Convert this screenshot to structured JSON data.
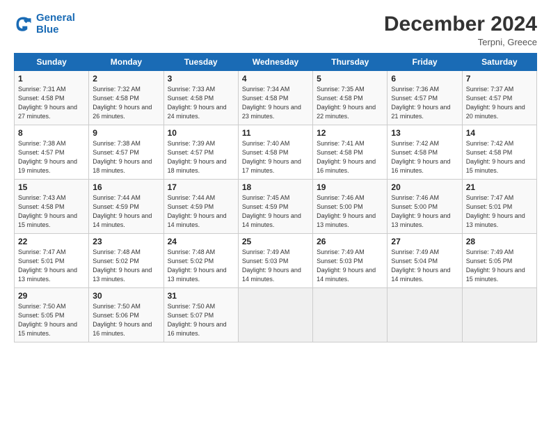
{
  "header": {
    "logo_line1": "General",
    "logo_line2": "Blue",
    "month": "December 2024",
    "location": "Terpni, Greece"
  },
  "columns": [
    "Sunday",
    "Monday",
    "Tuesday",
    "Wednesday",
    "Thursday",
    "Friday",
    "Saturday"
  ],
  "weeks": [
    [
      {
        "day": "1",
        "sunrise": "7:31 AM",
        "sunset": "4:58 PM",
        "daylight": "9 hours and 27 minutes."
      },
      {
        "day": "2",
        "sunrise": "7:32 AM",
        "sunset": "4:58 PM",
        "daylight": "9 hours and 26 minutes."
      },
      {
        "day": "3",
        "sunrise": "7:33 AM",
        "sunset": "4:58 PM",
        "daylight": "9 hours and 24 minutes."
      },
      {
        "day": "4",
        "sunrise": "7:34 AM",
        "sunset": "4:58 PM",
        "daylight": "9 hours and 23 minutes."
      },
      {
        "day": "5",
        "sunrise": "7:35 AM",
        "sunset": "4:58 PM",
        "daylight": "9 hours and 22 minutes."
      },
      {
        "day": "6",
        "sunrise": "7:36 AM",
        "sunset": "4:57 PM",
        "daylight": "9 hours and 21 minutes."
      },
      {
        "day": "7",
        "sunrise": "7:37 AM",
        "sunset": "4:57 PM",
        "daylight": "9 hours and 20 minutes."
      }
    ],
    [
      {
        "day": "8",
        "sunrise": "7:38 AM",
        "sunset": "4:57 PM",
        "daylight": "9 hours and 19 minutes."
      },
      {
        "day": "9",
        "sunrise": "7:38 AM",
        "sunset": "4:57 PM",
        "daylight": "9 hours and 18 minutes."
      },
      {
        "day": "10",
        "sunrise": "7:39 AM",
        "sunset": "4:57 PM",
        "daylight": "9 hours and 18 minutes."
      },
      {
        "day": "11",
        "sunrise": "7:40 AM",
        "sunset": "4:58 PM",
        "daylight": "9 hours and 17 minutes."
      },
      {
        "day": "12",
        "sunrise": "7:41 AM",
        "sunset": "4:58 PM",
        "daylight": "9 hours and 16 minutes."
      },
      {
        "day": "13",
        "sunrise": "7:42 AM",
        "sunset": "4:58 PM",
        "daylight": "9 hours and 16 minutes."
      },
      {
        "day": "14",
        "sunrise": "7:42 AM",
        "sunset": "4:58 PM",
        "daylight": "9 hours and 15 minutes."
      }
    ],
    [
      {
        "day": "15",
        "sunrise": "7:43 AM",
        "sunset": "4:58 PM",
        "daylight": "9 hours and 15 minutes."
      },
      {
        "day": "16",
        "sunrise": "7:44 AM",
        "sunset": "4:59 PM",
        "daylight": "9 hours and 14 minutes."
      },
      {
        "day": "17",
        "sunrise": "7:44 AM",
        "sunset": "4:59 PM",
        "daylight": "9 hours and 14 minutes."
      },
      {
        "day": "18",
        "sunrise": "7:45 AM",
        "sunset": "4:59 PM",
        "daylight": "9 hours and 14 minutes."
      },
      {
        "day": "19",
        "sunrise": "7:46 AM",
        "sunset": "5:00 PM",
        "daylight": "9 hours and 13 minutes."
      },
      {
        "day": "20",
        "sunrise": "7:46 AM",
        "sunset": "5:00 PM",
        "daylight": "9 hours and 13 minutes."
      },
      {
        "day": "21",
        "sunrise": "7:47 AM",
        "sunset": "5:01 PM",
        "daylight": "9 hours and 13 minutes."
      }
    ],
    [
      {
        "day": "22",
        "sunrise": "7:47 AM",
        "sunset": "5:01 PM",
        "daylight": "9 hours and 13 minutes."
      },
      {
        "day": "23",
        "sunrise": "7:48 AM",
        "sunset": "5:02 PM",
        "daylight": "9 hours and 13 minutes."
      },
      {
        "day": "24",
        "sunrise": "7:48 AM",
        "sunset": "5:02 PM",
        "daylight": "9 hours and 13 minutes."
      },
      {
        "day": "25",
        "sunrise": "7:49 AM",
        "sunset": "5:03 PM",
        "daylight": "9 hours and 14 minutes."
      },
      {
        "day": "26",
        "sunrise": "7:49 AM",
        "sunset": "5:03 PM",
        "daylight": "9 hours and 14 minutes."
      },
      {
        "day": "27",
        "sunrise": "7:49 AM",
        "sunset": "5:04 PM",
        "daylight": "9 hours and 14 minutes."
      },
      {
        "day": "28",
        "sunrise": "7:49 AM",
        "sunset": "5:05 PM",
        "daylight": "9 hours and 15 minutes."
      }
    ],
    [
      {
        "day": "29",
        "sunrise": "7:50 AM",
        "sunset": "5:05 PM",
        "daylight": "9 hours and 15 minutes."
      },
      {
        "day": "30",
        "sunrise": "7:50 AM",
        "sunset": "5:06 PM",
        "daylight": "9 hours and 16 minutes."
      },
      {
        "day": "31",
        "sunrise": "7:50 AM",
        "sunset": "5:07 PM",
        "daylight": "9 hours and 16 minutes."
      },
      null,
      null,
      null,
      null
    ]
  ]
}
